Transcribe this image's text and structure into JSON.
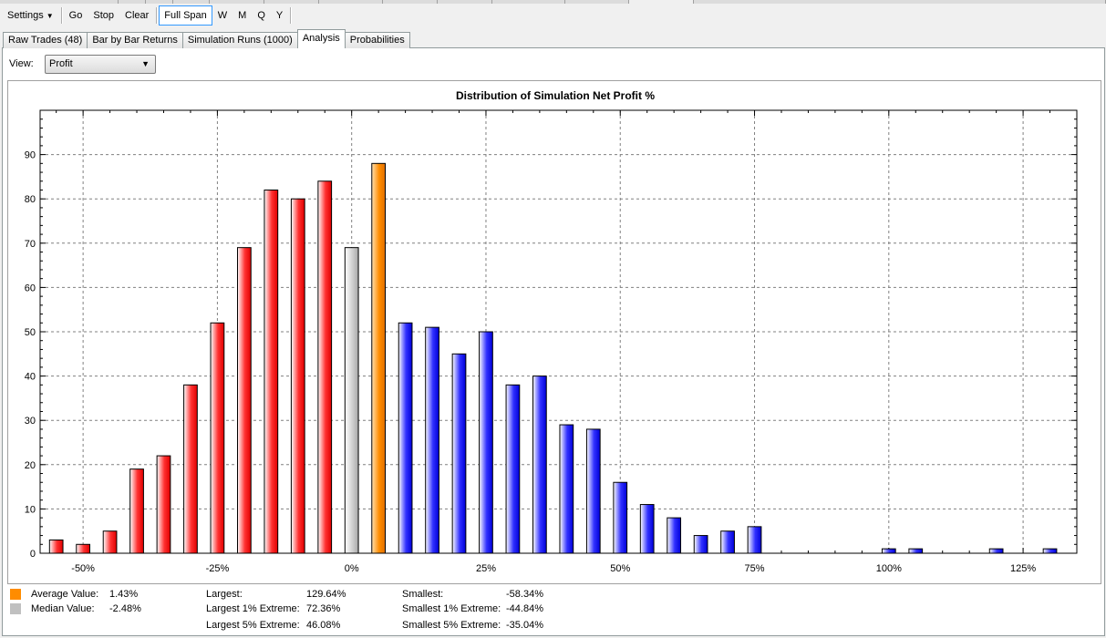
{
  "toolbar": {
    "settings_label": "Settings",
    "go_label": "Go",
    "stop_label": "Stop",
    "clear_label": "Clear",
    "full_span_label": "Full Span",
    "w_label": "W",
    "m_label": "M",
    "q_label": "Q",
    "y_label": "Y"
  },
  "tabs": [
    {
      "label": "Raw Trades (48)"
    },
    {
      "label": "Bar by Bar Returns"
    },
    {
      "label": "Simulation Runs (1000)"
    },
    {
      "label": "Analysis"
    },
    {
      "label": "Probabilities"
    }
  ],
  "view": {
    "label": "View:",
    "selected": "Profit"
  },
  "colors": {
    "negative": "#ff2020",
    "positive": "#2020ff",
    "median": "#c0c0c0",
    "average": "#ff8c00"
  },
  "chart_data": {
    "type": "bar",
    "title": "Distribution of Simulation Net Profit %",
    "xlabel": "",
    "ylabel": "",
    "x_tick_labels": [
      "-50%",
      "-25%",
      "0%",
      "25%",
      "50%",
      "75%",
      "100%",
      "125%"
    ],
    "x_ticks": [
      -50,
      -25,
      0,
      25,
      50,
      75,
      100,
      125
    ],
    "xlim": [
      -58,
      135
    ],
    "ylim": [
      0,
      100
    ],
    "y_ticks": [
      0,
      10,
      20,
      30,
      40,
      50,
      60,
      70,
      80,
      90
    ],
    "grid": true,
    "bars": [
      {
        "x": -55,
        "value": 3,
        "kind": "negative"
      },
      {
        "x": -50,
        "value": 2,
        "kind": "negative"
      },
      {
        "x": -45,
        "value": 5,
        "kind": "negative"
      },
      {
        "x": -40,
        "value": 19,
        "kind": "negative"
      },
      {
        "x": -35,
        "value": 22,
        "kind": "negative"
      },
      {
        "x": -30,
        "value": 38,
        "kind": "negative"
      },
      {
        "x": -25,
        "value": 52,
        "kind": "negative"
      },
      {
        "x": -20,
        "value": 69,
        "kind": "negative"
      },
      {
        "x": -15,
        "value": 82,
        "kind": "negative"
      },
      {
        "x": -10,
        "value": 80,
        "kind": "negative"
      },
      {
        "x": -5,
        "value": 84,
        "kind": "negative"
      },
      {
        "x": 0,
        "value": 69,
        "kind": "median"
      },
      {
        "x": 5,
        "value": 88,
        "kind": "average"
      },
      {
        "x": 10,
        "value": 52,
        "kind": "positive"
      },
      {
        "x": 15,
        "value": 51,
        "kind": "positive"
      },
      {
        "x": 20,
        "value": 45,
        "kind": "positive"
      },
      {
        "x": 25,
        "value": 50,
        "kind": "positive"
      },
      {
        "x": 30,
        "value": 38,
        "kind": "positive"
      },
      {
        "x": 35,
        "value": 40,
        "kind": "positive"
      },
      {
        "x": 40,
        "value": 29,
        "kind": "positive"
      },
      {
        "x": 45,
        "value": 28,
        "kind": "positive"
      },
      {
        "x": 50,
        "value": 16,
        "kind": "positive"
      },
      {
        "x": 55,
        "value": 11,
        "kind": "positive"
      },
      {
        "x": 60,
        "value": 8,
        "kind": "positive"
      },
      {
        "x": 65,
        "value": 4,
        "kind": "positive"
      },
      {
        "x": 70,
        "value": 5,
        "kind": "positive"
      },
      {
        "x": 75,
        "value": 6,
        "kind": "positive"
      },
      {
        "x": 100,
        "value": 1,
        "kind": "positive"
      },
      {
        "x": 105,
        "value": 1,
        "kind": "positive"
      },
      {
        "x": 120,
        "value": 1,
        "kind": "positive"
      },
      {
        "x": 130,
        "value": 1,
        "kind": "positive"
      }
    ]
  },
  "stats": {
    "average_label": "Average Value:",
    "average_value": "1.43%",
    "median_label": "Median Value:",
    "median_value": "-2.48%",
    "largest_label": "Largest:",
    "largest_value": "129.64%",
    "largest1_label": "Largest 1% Extreme:",
    "largest1_value": "72.36%",
    "largest5_label": "Largest 5% Extreme:",
    "largest5_value": "46.08%",
    "smallest_label": "Smallest:",
    "smallest_value": "-58.34%",
    "smallest1_label": "Smallest 1% Extreme:",
    "smallest1_value": "-44.84%",
    "smallest5_label": "Smallest 5% Extreme:",
    "smallest5_value": "-35.04%"
  }
}
